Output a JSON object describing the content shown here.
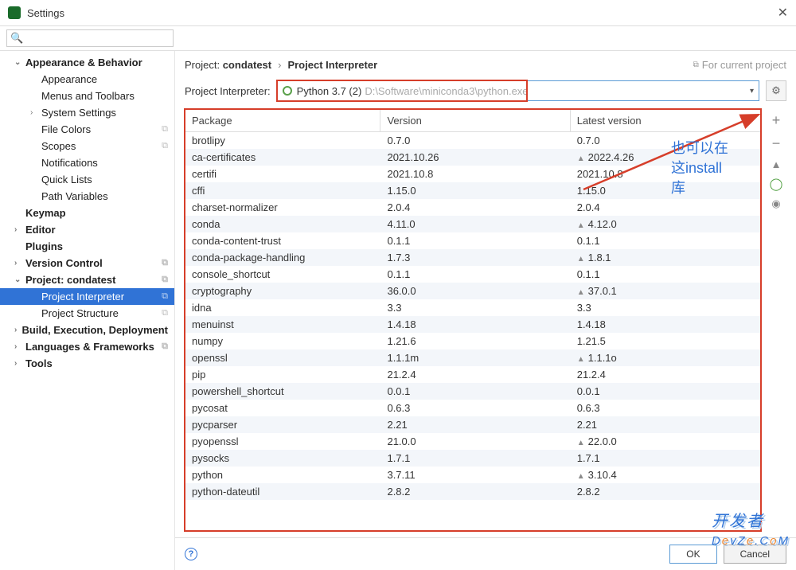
{
  "titlebar": {
    "title": "Settings"
  },
  "search": {
    "placeholder": ""
  },
  "sidebar": {
    "items": [
      {
        "label": "Appearance & Behavior",
        "bold": true,
        "chev": "v",
        "depth": 1
      },
      {
        "label": "Appearance",
        "depth": 2
      },
      {
        "label": "Menus and Toolbars",
        "depth": 2
      },
      {
        "label": "System Settings",
        "depth": 2,
        "chev": ">"
      },
      {
        "label": "File Colors",
        "depth": 2,
        "pin": true
      },
      {
        "label": "Scopes",
        "depth": 2,
        "pin": true
      },
      {
        "label": "Notifications",
        "depth": 2
      },
      {
        "label": "Quick Lists",
        "depth": 2
      },
      {
        "label": "Path Variables",
        "depth": 2
      },
      {
        "label": "Keymap",
        "bold": true,
        "depth": 1
      },
      {
        "label": "Editor",
        "bold": true,
        "chev": ">",
        "depth": 1
      },
      {
        "label": "Plugins",
        "bold": true,
        "depth": 1
      },
      {
        "label": "Version Control",
        "bold": true,
        "chev": ">",
        "depth": 1,
        "pin": true
      },
      {
        "label": "Project: condatest",
        "bold": true,
        "chev": "v",
        "depth": 1,
        "pin": true
      },
      {
        "label": "Project Interpreter",
        "depth": 2,
        "pin": true,
        "selected": true
      },
      {
        "label": "Project Structure",
        "depth": 2,
        "pin": true
      },
      {
        "label": "Build, Execution, Deployment",
        "bold": true,
        "chev": ">",
        "depth": 1
      },
      {
        "label": "Languages & Frameworks",
        "bold": true,
        "chev": ">",
        "depth": 1,
        "pin": true
      },
      {
        "label": "Tools",
        "bold": true,
        "chev": ">",
        "depth": 1
      }
    ]
  },
  "breadcrumb": {
    "proj_prefix": "Project:",
    "proj_name": "condatest",
    "page": "Project Interpreter",
    "current_project": "For current project"
  },
  "interpreter": {
    "label": "Project Interpreter:",
    "name": "Python 3.7 (2)",
    "path": "D:\\Software\\miniconda3\\python.exe"
  },
  "table": {
    "headers": {
      "package": "Package",
      "version": "Version",
      "latest": "Latest version"
    },
    "rows": [
      {
        "name": "brotlipy",
        "version": "0.7.0",
        "latest": "0.7.0"
      },
      {
        "name": "ca-certificates",
        "version": "2021.10.26",
        "latest": "2022.4.26",
        "up": true
      },
      {
        "name": "certifi",
        "version": "2021.10.8",
        "latest": "2021.10.8"
      },
      {
        "name": "cffi",
        "version": "1.15.0",
        "latest": "1.15.0"
      },
      {
        "name": "charset-normalizer",
        "version": "2.0.4",
        "latest": "2.0.4"
      },
      {
        "name": "conda",
        "version": "4.11.0",
        "latest": "4.12.0",
        "up": true
      },
      {
        "name": "conda-content-trust",
        "version": "0.1.1",
        "latest": "0.1.1"
      },
      {
        "name": "conda-package-handling",
        "version": "1.7.3",
        "latest": "1.8.1",
        "up": true
      },
      {
        "name": "console_shortcut",
        "version": "0.1.1",
        "latest": "0.1.1"
      },
      {
        "name": "cryptography",
        "version": "36.0.0",
        "latest": "37.0.1",
        "up": true
      },
      {
        "name": "idna",
        "version": "3.3",
        "latest": "3.3"
      },
      {
        "name": "menuinst",
        "version": "1.4.18",
        "latest": "1.4.18"
      },
      {
        "name": "numpy",
        "version": "1.21.6",
        "latest": "1.21.5"
      },
      {
        "name": "openssl",
        "version": "1.1.1m",
        "latest": "1.1.1o",
        "up": true
      },
      {
        "name": "pip",
        "version": "21.2.4",
        "latest": "21.2.4"
      },
      {
        "name": "powershell_shortcut",
        "version": "0.0.1",
        "latest": "0.0.1"
      },
      {
        "name": "pycosat",
        "version": "0.6.3",
        "latest": "0.6.3"
      },
      {
        "name": "pycparser",
        "version": "2.21",
        "latest": "2.21"
      },
      {
        "name": "pyopenssl",
        "version": "21.0.0",
        "latest": "22.0.0",
        "up": true
      },
      {
        "name": "pysocks",
        "version": "1.7.1",
        "latest": "1.7.1"
      },
      {
        "name": "python",
        "version": "3.7.11",
        "latest": "3.10.4",
        "up": true
      },
      {
        "name": "python-dateutil",
        "version": "2.8.2",
        "latest": "2.8.2"
      }
    ]
  },
  "annotation": {
    "line1": "也可以在",
    "line2": "这install",
    "line3": "库"
  },
  "buttons": {
    "ok": "OK",
    "cancel": "Cancel"
  },
  "watermark": "开发者\nDevZe.CoM"
}
